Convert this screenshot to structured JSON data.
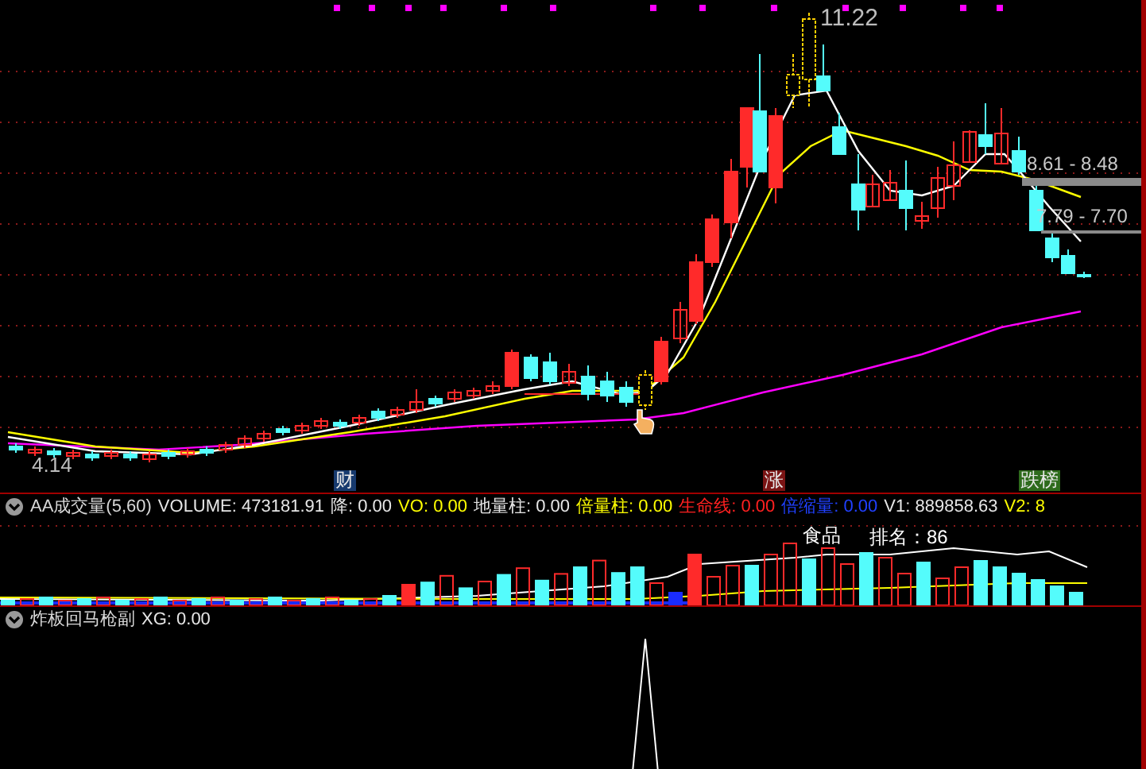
{
  "main_chart": {
    "price_labels": [
      {
        "kind": "high",
        "text": "11.22"
      },
      {
        "kind": "low",
        "text": "4.14"
      },
      {
        "kind": "band",
        "text": "8.61 - 8.48"
      },
      {
        "kind": "band",
        "text": "7.79 - 7.70"
      }
    ],
    "markers": [
      {
        "text": "财",
        "color": "#173a6e"
      },
      {
        "text": "涨",
        "color": "#7a1414"
      },
      {
        "text": "跌榜",
        "color": "#2e6b1c"
      }
    ]
  },
  "volume_panel": {
    "title": "AA成交量(5,60)",
    "fields": [
      {
        "label": "VOLUME:",
        "value": "473181.91",
        "color": "#e6e6e6"
      },
      {
        "label": "降:",
        "value": "0.00",
        "color": "#e6e6e6"
      },
      {
        "label": "VO:",
        "value": "0.00",
        "color": "#ffff00"
      },
      {
        "label": "地量柱:",
        "value": "0.00",
        "color": "#e6e6e6"
      },
      {
        "label": "倍量柱:",
        "value": "0.00",
        "color": "#ffff00"
      },
      {
        "label": "生命线:",
        "value": "0.00",
        "color": "#ff2020"
      },
      {
        "label": "倍缩量:",
        "value": "0.00",
        "color": "#2040ff"
      },
      {
        "label": "V1:",
        "value": "889858.63",
        "color": "#e6e6e6"
      },
      {
        "label": "V2:",
        "value": "8",
        "color": "#ffff00"
      }
    ],
    "sector": "食品",
    "rank": "排名：86"
  },
  "signal_panel": {
    "title": "炸板回马枪副",
    "fields": [
      {
        "label": "XG:",
        "value": "0.00",
        "color": "#e6e6e6"
      }
    ]
  }
}
